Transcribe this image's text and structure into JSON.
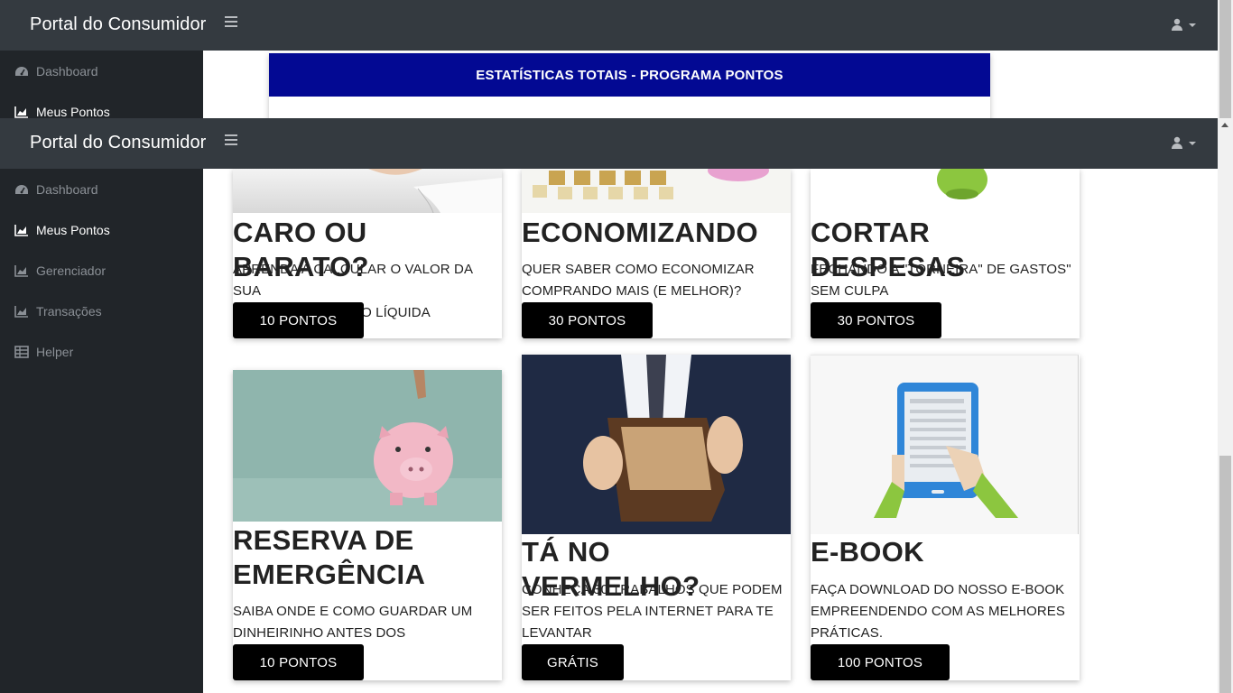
{
  "app": {
    "brand": "Portal do Consumidor"
  },
  "sidebar": {
    "items": [
      {
        "label": "Dashboard",
        "icon": "dashboard-icon"
      },
      {
        "label": "Meus Pontos",
        "icon": "chart-area-icon"
      },
      {
        "label": "Gerenciador",
        "icon": "chart-area-icon"
      },
      {
        "label": "Transações",
        "icon": "chart-area-icon"
      },
      {
        "label": "Helper",
        "icon": "table-icon"
      }
    ]
  },
  "stats": {
    "header": "ESTATÍSTICAS TOTAIS - PROGRAMA PONTOS"
  },
  "cards": [
    {
      "title": "CARO OU BARATO?",
      "desc_line1": "APRENDA A CALCULAR O VALOR DA SUA",
      "desc_line2": "HORA DE TRABALHO LÍQUIDA",
      "button": "10 PONTOS"
    },
    {
      "title": "ECONOMIZANDO",
      "desc_line1": "QUER SABER COMO ECONOMIZAR",
      "desc_line2": "COMPRANDO MAIS (E MELHOR)?",
      "button": "30 PONTOS"
    },
    {
      "title": "CORTAR DESPESAS",
      "desc_line1": "FECHANDO A \"TORNEIRA\" DE GASTOS\"",
      "desc_line2": "SEM CULPA",
      "button": "30 PONTOS"
    },
    {
      "title_line1": "RESERVA DE",
      "title_line2": "EMERGÊNCIA",
      "desc_line1": "SAIBA ONDE E COMO GUARDAR UM",
      "desc_line2": "DINHEIRINHO ANTES DOS IMPREVISTOS",
      "button": "10 PONTOS"
    },
    {
      "title": "TÁ NO VERMELHO?",
      "desc_line1": "CONHEÇA 30 TRABALHOS QUE PODEM",
      "desc_line2": "SER FEITOS PELA INTERNET PARA TE",
      "desc_line3": "LEVANTAR",
      "button": "GRÁTIS"
    },
    {
      "title": "E-BOOK",
      "desc_line1": "FAÇA DOWNLOAD DO NOSSO E-BOOK",
      "desc_line2": "EMPREENDENDO COM AS MELHORES",
      "desc_line3": "PRÁTICAS.",
      "button": "100 PONTOS"
    }
  ],
  "colors": {
    "topbar": "#343a40",
    "sidebar": "#212529",
    "stats_header": "#030993",
    "button": "#000000"
  }
}
